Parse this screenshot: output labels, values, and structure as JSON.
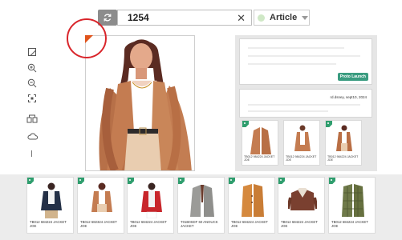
{
  "search": {
    "value": "1254",
    "clear_icon": "close-icon"
  },
  "type_selector": {
    "value": "Article"
  },
  "toolbar_icons": [
    "crop-icon",
    "zoom-in-icon",
    "zoom-out-icon",
    "fit-screen-icon",
    "compare-icon",
    "cloud-icon",
    "divider-line"
  ],
  "colors": {
    "accent_orange": "#e0541c",
    "marker_red": "#d9252b",
    "tag_green": "#2f9e6e",
    "badge_teal": "#3a9c80"
  },
  "right_panel": {
    "badge_label": "Proto Launch",
    "meta_text": "rd.dsney, sept10, 2024",
    "thumbs": [
      {
        "caption": "TB012 984224 JACKET JOE"
      },
      {
        "caption": "TB012 984224 JACKET JOE"
      },
      {
        "caption": "TB012 984224 JACKET JOE"
      }
    ]
  },
  "bottom_strip": [
    {
      "caption": "TB012 684224 JACKET JOE"
    },
    {
      "caption": "TB012 682324 JACKET JOE"
    },
    {
      "caption": "TB012 684224 JACKET JOE"
    },
    {
      "caption": "T01B0SDF 60 ANOUCK JACKET"
    },
    {
      "caption": "TB012 684224 JACKET JOE"
    },
    {
      "caption": "TB012 684224 JACKET JOE"
    },
    {
      "caption": "TB012 684224 JACKET JOE"
    }
  ]
}
